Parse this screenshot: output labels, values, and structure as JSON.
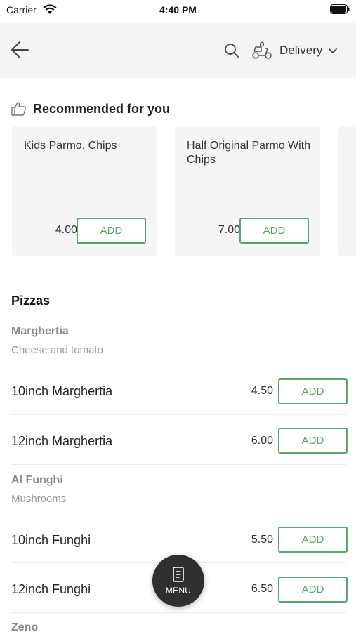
{
  "status_bar": {
    "carrier": "Carrier",
    "time": "4:40 PM"
  },
  "header": {
    "delivery_label": "Delivery"
  },
  "recommended": {
    "title": "Recommended for you",
    "items": [
      {
        "name": "Kids Parmo, Chips",
        "price": "4.00",
        "add_label": "ADD"
      },
      {
        "name": "Half Original Parmo With Chips",
        "price": "7.00",
        "add_label": "ADD"
      }
    ]
  },
  "menu": {
    "section_title": "Pizzas",
    "groups": [
      {
        "name": "Marghertia",
        "description": "Cheese and tomato",
        "items": [
          {
            "name": "10inch Marghertia",
            "price": "4.50",
            "add_label": "ADD"
          },
          {
            "name": "12inch Marghertia",
            "price": "6.00",
            "add_label": "ADD"
          }
        ]
      },
      {
        "name": "Al Funghi",
        "description": "Mushrooms",
        "items": [
          {
            "name": "10inch Funghi",
            "price": "5.50",
            "add_label": "ADD"
          },
          {
            "name": "12inch Funghi",
            "price": "6.50",
            "add_label": "ADD"
          }
        ]
      },
      {
        "name": "Zeno"
      }
    ]
  },
  "fab": {
    "label": "MENU"
  },
  "colors": {
    "accent": "#5aa46b",
    "header_bg": "#f5f5f5",
    "card_bg": "#f5f5f5",
    "fab_bg": "#2f2f2f"
  },
  "icons": [
    "wifi-icon",
    "battery-icon",
    "back-arrow-icon",
    "search-icon",
    "scooter-icon",
    "chevron-down-icon",
    "thumbs-up-icon",
    "menu-book-icon"
  ]
}
